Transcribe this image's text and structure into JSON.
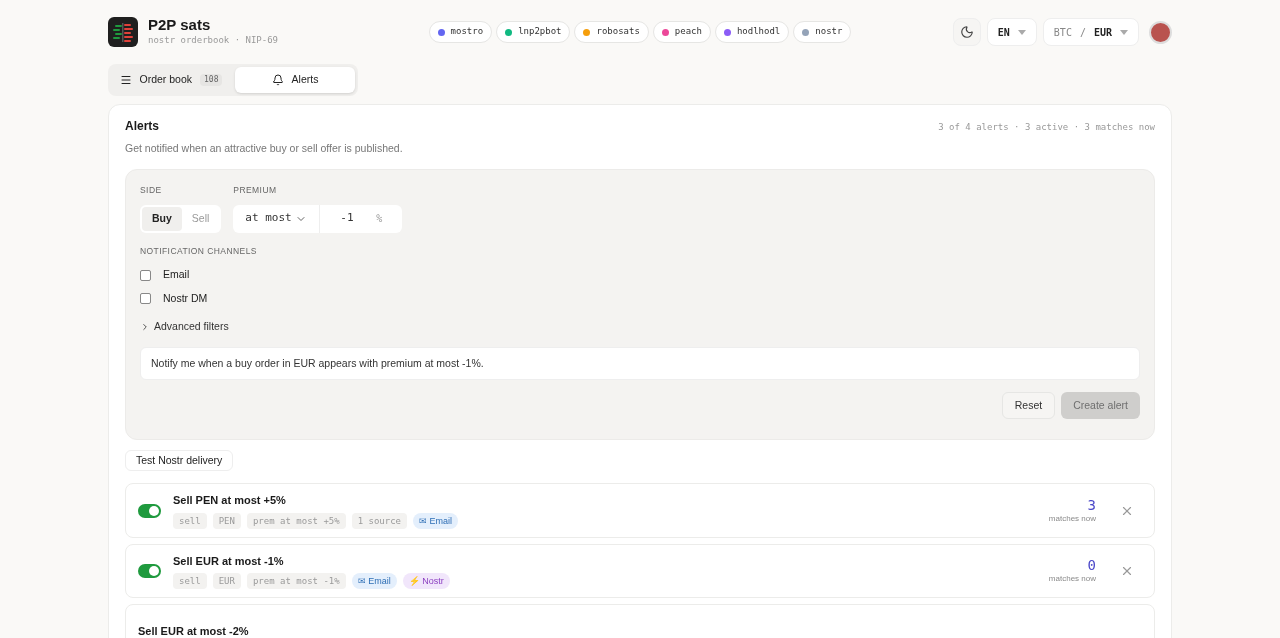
{
  "brand": {
    "title": "P2P sats",
    "subtitle": "nostr orderbook · NIP-69"
  },
  "sources": [
    {
      "name": "mostro",
      "color": "#6366f1"
    },
    {
      "name": "lnp2pbot",
      "color": "#10b981"
    },
    {
      "name": "robosats",
      "color": "#f59e0b"
    },
    {
      "name": "peach",
      "color": "#ec4899"
    },
    {
      "name": "hodlhodl",
      "color": "#8b5cf6"
    },
    {
      "name": "nostr",
      "color": "#94a3b8"
    }
  ],
  "language": "EN",
  "pair": {
    "base": "BTC",
    "separator": "/",
    "quote": "EUR"
  },
  "tabs": [
    {
      "label": "Order book",
      "count": "108",
      "selected": false
    },
    {
      "label": "Alerts",
      "selected": true
    }
  ],
  "alerts_panel": {
    "title": "Alerts",
    "description": "Get notified when an attractive buy or sell offer is published.",
    "summary": "3 of 4 alerts · 3 active · 3 matches now",
    "form": {
      "side_label": "SIDE",
      "sides": [
        {
          "label": "Buy",
          "selected": true
        },
        {
          "label": "Sell",
          "selected": false
        }
      ],
      "premium_label": "PREMIUM",
      "premium_mode": "at most",
      "premium_value": "-1",
      "premium_unit": "%",
      "channels_label": "NOTIFICATION CHANNELS",
      "channels": [
        {
          "label": "Email",
          "checked": false
        },
        {
          "label": "Nostr DM",
          "checked": false
        }
      ],
      "advanced": {
        "label": "Advanced filters",
        "expanded": false
      },
      "preview": "Notify me when a buy order in EUR appears with premium at most -1%.",
      "reset": "Reset",
      "create": {
        "label": "Create alert",
        "disabled": true
      }
    },
    "test_button": "Test Nostr delivery",
    "alerts": [
      {
        "title": "Sell PEN at most +5%",
        "on": true,
        "tags": [
          {
            "kind": "plain",
            "text": "sell"
          },
          {
            "kind": "plain",
            "text": "PEN"
          },
          {
            "kind": "plain",
            "text": "prem at most +5%"
          },
          {
            "kind": "plain",
            "text": "1 source"
          },
          {
            "kind": "email",
            "text": "✉ Email"
          }
        ],
        "matches": "3",
        "matches_label": "matches now"
      },
      {
        "title": "Sell EUR at most -1%",
        "on": true,
        "tags": [
          {
            "kind": "plain",
            "text": "sell"
          },
          {
            "kind": "plain",
            "text": "EUR"
          },
          {
            "kind": "plain",
            "text": "prem at most -1%"
          },
          {
            "kind": "email",
            "text": "✉ Email"
          },
          {
            "kind": "nostr",
            "text": "⚡ Nostr"
          }
        ],
        "matches": "0",
        "matches_label": "matches now"
      },
      {
        "title": "Sell EUR at most -2%"
      }
    ]
  }
}
